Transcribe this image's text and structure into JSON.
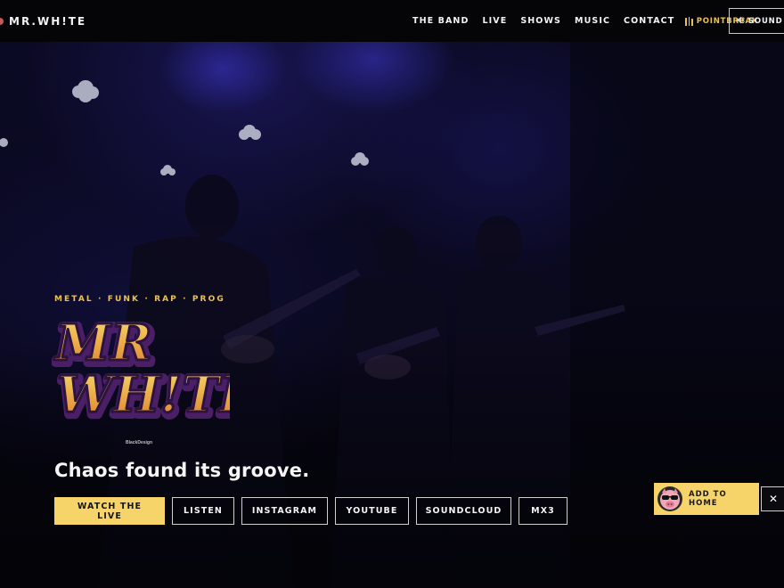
{
  "nav": {
    "brand": "MR.WH!TE",
    "links": [
      "THE BAND",
      "LIVE",
      "SHOWS",
      "MUSIC",
      "CONTACT"
    ],
    "pointbreak": {
      "label": "POINTBREAK",
      "icon": "equalizer-bars-icon",
      "color": "#e9c15b"
    },
    "sound": {
      "label": "SOUND",
      "icon": "speaker-icon"
    }
  },
  "hero": {
    "genres": "METAL · FUNK · RAP · PROG",
    "logo": {
      "text": "MR WH!TE",
      "colors": {
        "fill_top": "#f6d262",
        "fill_bottom": "#e0822c",
        "outline": "#3b1b4f",
        "shadow": "#4a1f66"
      }
    },
    "design_credit": "BlackDesign",
    "tagline": "Chaos found its groove.",
    "ctas": [
      "WATCH THE LIVE",
      "LISTEN",
      "INSTAGRAM",
      "YOUTUBE",
      "SOUNDCLOUD",
      "MX3"
    ]
  },
  "add_to_home": {
    "label": "ADD TO HOME",
    "avatar_icon": "pig-with-sunglasses-icon",
    "close_glyph": "✕"
  },
  "colors": {
    "accent": "#f7d46a",
    "background": "#050507"
  }
}
